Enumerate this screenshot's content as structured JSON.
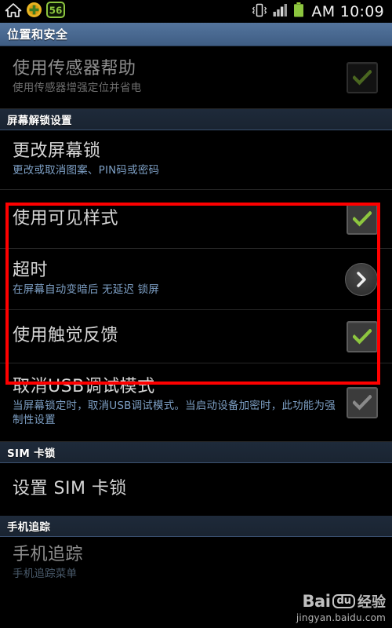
{
  "statusbar": {
    "icons_left": [
      "home-icon",
      "plus-badge-icon",
      "counter-badge-icon"
    ],
    "counter_value": "56",
    "icons_right": [
      "vibrate-icon",
      "signal-bars-icon",
      "battery-icon"
    ],
    "clock": "AM 10:09"
  },
  "titlebar": {
    "title": "位置和安全"
  },
  "sections": [
    {
      "header": null,
      "rows": [
        {
          "title": "使用传感器帮助",
          "subtitle": "使用传感器增强定位并省电",
          "widget": "checkbox",
          "checked": true,
          "enabled": false
        }
      ]
    },
    {
      "header": "屏幕解锁设置",
      "rows": [
        {
          "title": "更改屏幕锁",
          "subtitle": "更改或取消图案、PIN码或密码",
          "widget": "none",
          "checked": false,
          "enabled": true
        },
        {
          "title": "使用可见样式",
          "subtitle": "",
          "widget": "checkbox",
          "checked": true,
          "enabled": true
        },
        {
          "title": "超时",
          "subtitle": "在屏幕自动变暗后 无延迟 锁屏",
          "widget": "chevron",
          "checked": false,
          "enabled": true
        },
        {
          "title": "使用触觉反馈",
          "subtitle": "",
          "widget": "checkbox",
          "checked": true,
          "enabled": true
        },
        {
          "title": "取消USB调试模式",
          "subtitle": "当屏幕锁定时，取消USB调试模式。当启动设备加密时，此功能为强制性设置",
          "widget": "checkbox",
          "checked": true,
          "enabled": false
        }
      ]
    },
    {
      "header": "SIM 卡锁",
      "rows": [
        {
          "title": "设置 SIM 卡锁",
          "subtitle": "",
          "widget": "none",
          "checked": false,
          "enabled": true
        }
      ]
    },
    {
      "header": "手机追踪",
      "rows": [
        {
          "title": "手机追踪",
          "subtitle": "手机追踪菜单",
          "widget": "none",
          "checked": false,
          "enabled": true
        }
      ]
    }
  ],
  "highlight": {
    "name": "red-annotation-box",
    "color": "#ff0000",
    "covers": [
      "使用可见样式",
      "超时",
      "使用触觉反馈"
    ]
  },
  "watermark": {
    "bai": "Bai",
    "du": "du",
    "jingyan": "经验",
    "url": "jingyan.baidu.com"
  },
  "colors": {
    "background": "#000000",
    "titlebar": "#4a6a92",
    "section_header": "#1e2a3a",
    "title_text": "#d6d6d6",
    "subtitle_text": "#7d9fc4",
    "check_green": "#8dc63f",
    "highlight_red": "#ff0000"
  }
}
